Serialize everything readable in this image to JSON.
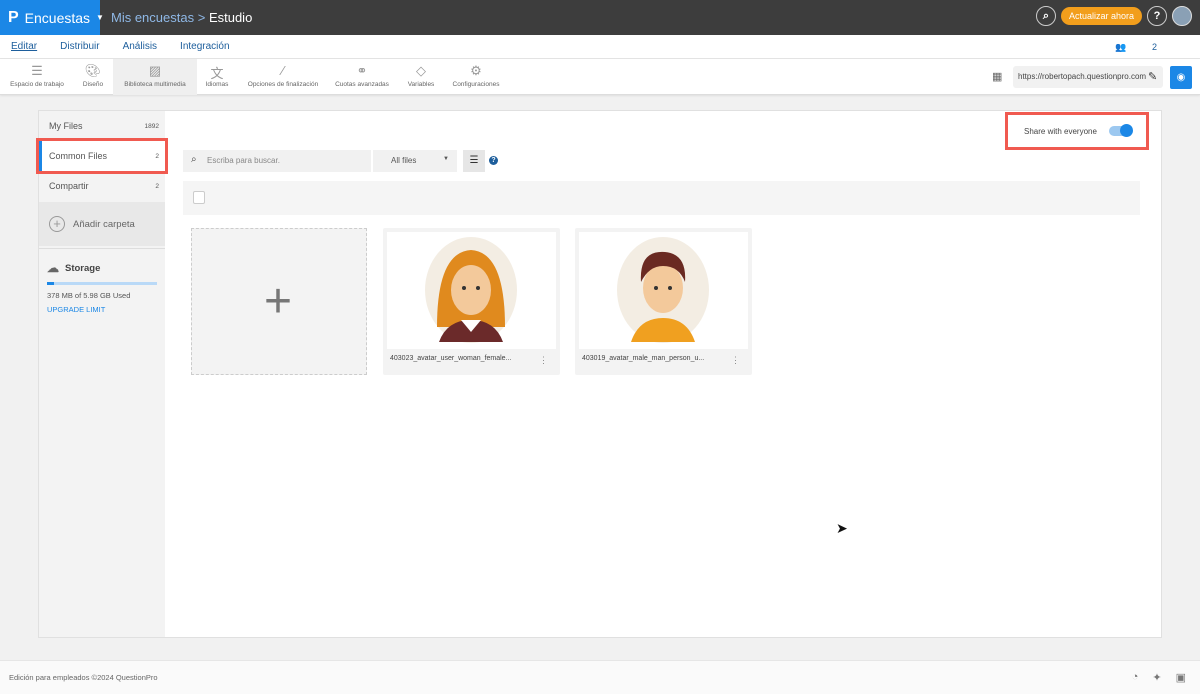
{
  "header": {
    "app": "Encuestas",
    "breadcrumb_parent": "Mis encuestas",
    "breadcrumb_sep": ">",
    "breadcrumb_current": "Estudio",
    "upgrade": "Actualizar ahora",
    "help": "?"
  },
  "nav": {
    "tabs": [
      "Editar",
      "Distribuir",
      "Análisis",
      "Integración"
    ],
    "active": "Editar",
    "collaborators": "2"
  },
  "toolbar": {
    "items": [
      {
        "label": "Espacio de trabajo",
        "icon": "workspace-icon"
      },
      {
        "label": "Diseño",
        "icon": "palette-icon"
      },
      {
        "label": "Biblioteca multimedia",
        "icon": "image-icon"
      },
      {
        "label": "Idiomas",
        "icon": "translate-icon"
      },
      {
        "label": "Opciones de finalización",
        "icon": "magic-wand-icon"
      },
      {
        "label": "Cuotas avanzadas",
        "icon": "quota-icon"
      },
      {
        "label": "Variables",
        "icon": "tag-icon"
      },
      {
        "label": "Configuraciones",
        "icon": "gear-icon"
      }
    ],
    "selected": "Biblioteca multimedia",
    "url": "https://robertopach.questionpro.com"
  },
  "sidebar": {
    "items": [
      {
        "label": "My Files",
        "count": "1892"
      },
      {
        "label": "Common Files",
        "count": "2"
      },
      {
        "label": "Compartir",
        "count": "2"
      }
    ],
    "add_folder": "Añadir carpeta",
    "storage_title": "Storage",
    "storage_used": "378 MB of 5.98 GB Used",
    "storage_fraction": 0.062,
    "upgrade_limit": "UPGRADE LIMIT"
  },
  "main": {
    "share_label": "Share with everyone",
    "share_on": true,
    "search_placeholder": "Escriba para buscar.",
    "filter": "All files",
    "files": [
      {
        "name": "403023_avatar_user_woman_female..."
      },
      {
        "name": "403019_avatar_male_man_person_u..."
      }
    ]
  },
  "footer": {
    "text": "Edición para empleados ©2024 QuestionPro"
  },
  "colors": {
    "brand": "#1b87e6",
    "topbar": "#3d3d3d",
    "upgrade": "#f29e1c",
    "highlight": "#f05a50"
  }
}
